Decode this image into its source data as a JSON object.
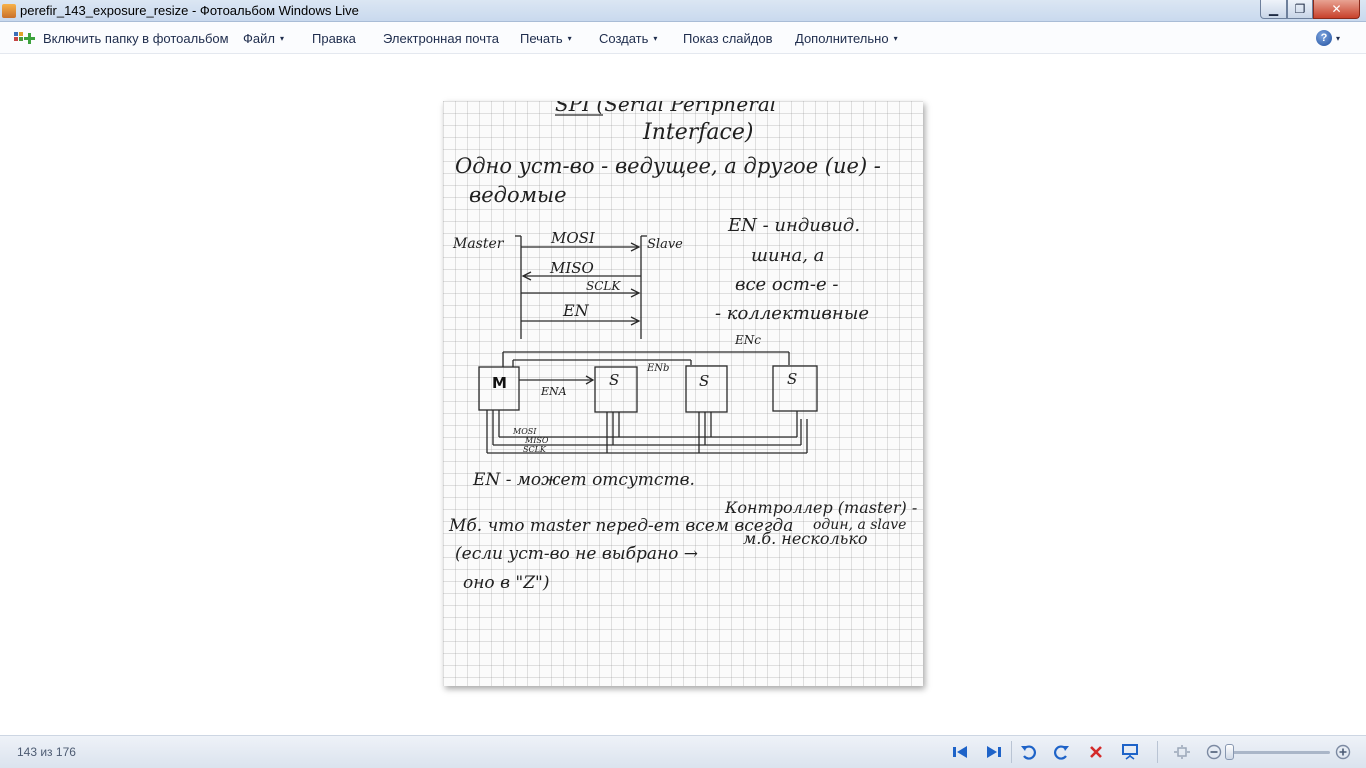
{
  "window": {
    "title": "perefir_143_exposure_resize - Фотоальбом Windows Live",
    "minimize_glyph": "▁",
    "maximize_glyph": "❐",
    "close_glyph": "✕"
  },
  "menubar": {
    "items": [
      {
        "label": "Включить папку в фотоальбом",
        "dropdown": false
      },
      {
        "label": "Файл",
        "dropdown": true
      },
      {
        "label": "Правка",
        "dropdown": false
      },
      {
        "label": "Электронная почта",
        "dropdown": false
      },
      {
        "label": "Печать",
        "dropdown": true
      },
      {
        "label": "Создать",
        "dropdown": true
      },
      {
        "label": "Показ слайдов",
        "dropdown": false
      },
      {
        "label": "Дополнительно",
        "dropdown": true
      }
    ],
    "help_glyph": "?",
    "caret": "▾",
    "include_icon": "folder-add-icon"
  },
  "photo": {
    "description_lines": {
      "title_a": "SPI (Serial Peripheral",
      "title_b": "Interface)",
      "line1": "Одно уст-во - ведущее, а другое (ие) -",
      "line2": "ведомые",
      "master": "Master",
      "slave": "Slave",
      "mosi": "MOSI",
      "miso": "MISO",
      "sclk": "SCLK",
      "en": "EN",
      "note1": "EN - индивид.",
      "note2": "шина, а",
      "note3": "все ост-е -",
      "note4": "- коллективные",
      "en_c": "ENc",
      "en_b": "ENb",
      "en_a": "ENA",
      "m_box": "M",
      "s_box": "S",
      "mosi_small": "MOSI",
      "miso_small": "MISO",
      "sclk_small": "SCLK",
      "absent": "EN - может отсутств.",
      "controller1": "Контроллер (master) -",
      "controller2": "один, а slave",
      "controller3": "м.б. несколько",
      "bottom1": "Мб. что master перед-ет всем всегда",
      "bottom2": "(если уст-во не выбрано →",
      "bottom3": "оно в \"Z\")"
    }
  },
  "statusbar": {
    "counter": "143 из 176",
    "controls": [
      "previous-icon",
      "next-icon",
      "rotate-left-icon",
      "rotate-right-icon",
      "delete-icon",
      "slideshow-icon",
      "fit-icon",
      "zoom-out-icon",
      "zoom-in-icon"
    ]
  },
  "colors": {
    "accent": "#1e63c8",
    "delete": "#d42a2a"
  }
}
